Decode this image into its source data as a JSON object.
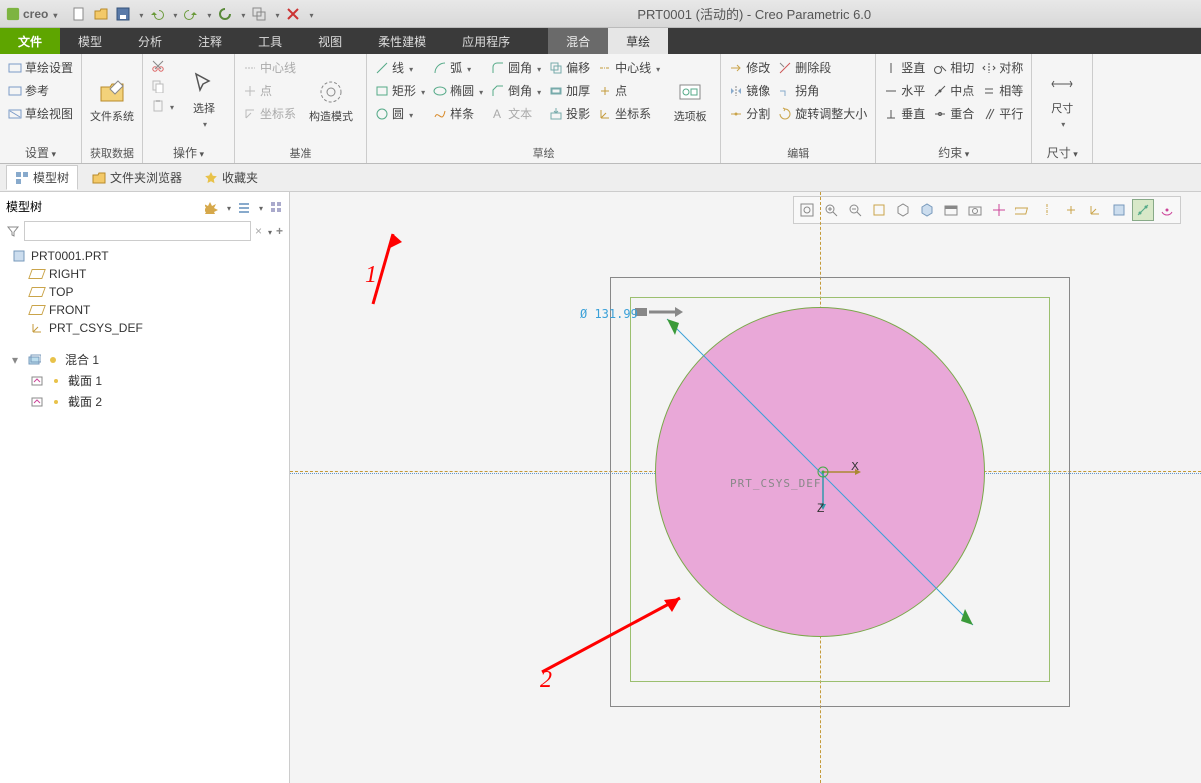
{
  "app": {
    "name": "creo",
    "title": "PRT0001 (活动的) - Creo Parametric 6.0"
  },
  "tabs": {
    "file": "文件",
    "items": [
      "模型",
      "分析",
      "注释",
      "工具",
      "视图",
      "柔性建模",
      "应用程序"
    ],
    "ctx": [
      "混合",
      "草绘"
    ]
  },
  "ribbon": {
    "settings": {
      "label": "设置",
      "items": [
        "草绘设置",
        "参考",
        "草绘视图"
      ]
    },
    "getdata": {
      "label": "获取数据",
      "btn": "文件系统"
    },
    "ops": {
      "label": "操作",
      "sel": "选择"
    },
    "datum": {
      "label": "基准",
      "items": [
        "中心线",
        "点",
        "坐标系"
      ],
      "mode": "构造模式"
    },
    "sketch": {
      "label": "草绘",
      "col1": [
        "线",
        "矩形",
        "圆"
      ],
      "col2": [
        "弧",
        "椭圆",
        "样条"
      ],
      "col3": [
        "圆角",
        "倒角",
        "文本"
      ],
      "col4": [
        "偏移",
        "加厚",
        "投影"
      ],
      "col5": [
        "中心线",
        "点",
        "坐标系"
      ],
      "panel": "选项板"
    },
    "edit": {
      "label": "编辑",
      "items": [
        [
          "修改",
          "删除段"
        ],
        [
          "镜像",
          "拐角"
        ],
        [
          "分割",
          "旋转调整大小"
        ]
      ]
    },
    "constrain": {
      "label": "约束",
      "items": [
        [
          "竖直",
          "相切",
          "对称"
        ],
        [
          "水平",
          "中点",
          "相等"
        ],
        [
          "垂直",
          "重合",
          "平行"
        ]
      ]
    },
    "dim": {
      "label": "尺寸",
      "btn": "尺寸"
    }
  },
  "treetabs": {
    "model": "模型树",
    "folder": "文件夹浏览器",
    "fav": "收藏夹"
  },
  "sidebar": {
    "title": "模型树",
    "root": "PRT0001.PRT",
    "datums": [
      "RIGHT",
      "TOP",
      "FRONT"
    ],
    "csys": "PRT_CSYS_DEF",
    "feature": "混合 1",
    "sections": [
      "截面 1",
      "截面 2"
    ]
  },
  "canvas": {
    "dim_value": "Ø  131.99",
    "csys_label": "PRT_CSYS_DEF",
    "axis_x": "X",
    "axis_z": "Z",
    "ann1": "1",
    "ann2": "2"
  }
}
